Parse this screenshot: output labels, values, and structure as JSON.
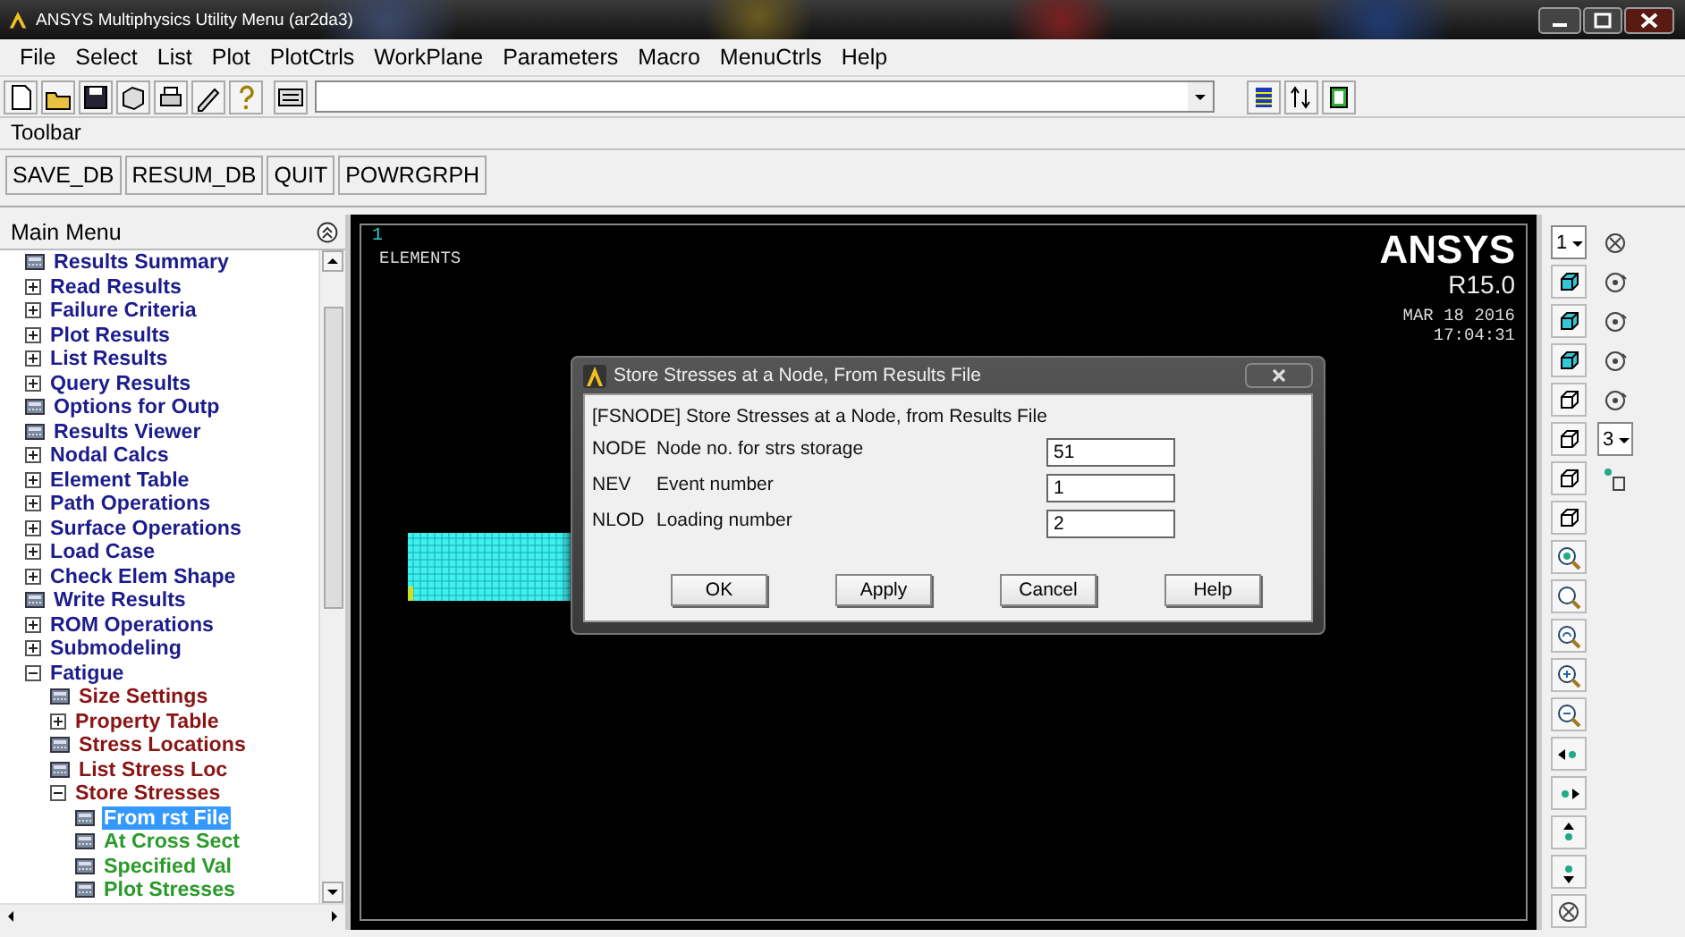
{
  "window": {
    "title": "ANSYS Multiphysics Utility Menu (ar2da3)"
  },
  "menu_bar": [
    "File",
    "Select",
    "List",
    "Plot",
    "PlotCtrls",
    "WorkPlane",
    "Parameters",
    "Macro",
    "MenuCtrls",
    "Help"
  ],
  "toolbar": {
    "label": "Toolbar",
    "buttons": [
      "SAVE_DB",
      "RESUM_DB",
      "QUIT",
      "POWRGRPH"
    ]
  },
  "main_menu": {
    "title": "Main Menu",
    "items": [
      {
        "label": "Results Summary",
        "kind": "leaf",
        "selected": false
      },
      {
        "label": "Read Results",
        "kind": "branch",
        "expanded": false,
        "selected": false
      },
      {
        "label": "Failure Criteria",
        "kind": "branch",
        "expanded": false,
        "selected": false
      },
      {
        "label": "Plot Results",
        "kind": "branch",
        "expanded": false,
        "selected": false
      },
      {
        "label": "List Results",
        "kind": "branch",
        "expanded": false,
        "selected": false
      },
      {
        "label": "Query Results",
        "kind": "branch",
        "expanded": false,
        "selected": false
      },
      {
        "label": "Options for Outp",
        "kind": "leaf",
        "selected": false
      },
      {
        "label": "Results Viewer",
        "kind": "leaf",
        "selected": false
      },
      {
        "label": "Nodal Calcs",
        "kind": "branch",
        "expanded": false,
        "selected": false
      },
      {
        "label": "Element Table",
        "kind": "branch",
        "expanded": false,
        "selected": false
      },
      {
        "label": "Path Operations",
        "kind": "branch",
        "expanded": false,
        "selected": false
      },
      {
        "label": "Surface Operations",
        "kind": "branch",
        "expanded": false,
        "selected": false
      },
      {
        "label": "Load Case",
        "kind": "branch",
        "expanded": false,
        "selected": false
      },
      {
        "label": "Check Elem Shape",
        "kind": "branch",
        "expanded": false,
        "selected": false
      },
      {
        "label": "Write Results",
        "kind": "leaf",
        "selected": false
      },
      {
        "label": "ROM Operations",
        "kind": "branch",
        "expanded": false,
        "selected": false
      },
      {
        "label": "Submodeling",
        "kind": "branch",
        "expanded": false,
        "selected": false
      },
      {
        "label": "Fatigue",
        "kind": "branch",
        "expanded": true,
        "selected": false,
        "children": [
          {
            "label": "Size Settings",
            "kind": "leaf",
            "selected": false
          },
          {
            "label": "Property Table",
            "kind": "branch",
            "expanded": false,
            "selected": false
          },
          {
            "label": "Stress Locations",
            "kind": "leaf",
            "selected": false
          },
          {
            "label": "List Stress Loc",
            "kind": "leaf",
            "selected": false
          },
          {
            "label": "Store Stresses",
            "kind": "branch",
            "expanded": true,
            "selected": false,
            "children": [
              {
                "label": "From rst File",
                "kind": "leaf",
                "selected": true
              },
              {
                "label": "At Cross Sect",
                "kind": "leaf",
                "selected": false
              },
              {
                "label": "Specified Val",
                "kind": "leaf",
                "selected": false
              },
              {
                "label": "Plot Stresses",
                "kind": "leaf",
                "selected": false
              }
            ]
          }
        ]
      }
    ]
  },
  "graphics": {
    "window_number": "1",
    "plot_label": "ELEMENTS",
    "logo": "ANSYS",
    "release": "R15.0",
    "date": "MAR 18 2016",
    "time": "17:04:31"
  },
  "dialog": {
    "title": "Store Stresses at a Node, From Results File",
    "heading": "[FSNODE]  Store Stresses at a Node, from Results File",
    "fields": [
      {
        "key": "NODE",
        "label": "Node no. for strs storage",
        "value": "51"
      },
      {
        "key": "NEV",
        "label": "Event number",
        "value": "1"
      },
      {
        "key": "NLOD",
        "label": "Loading number",
        "value": "2"
      }
    ],
    "buttons": [
      "OK",
      "Apply",
      "Cancel",
      "Help"
    ]
  },
  "view_toolbar": {
    "window_selector": "1",
    "increment_selector": "3"
  }
}
